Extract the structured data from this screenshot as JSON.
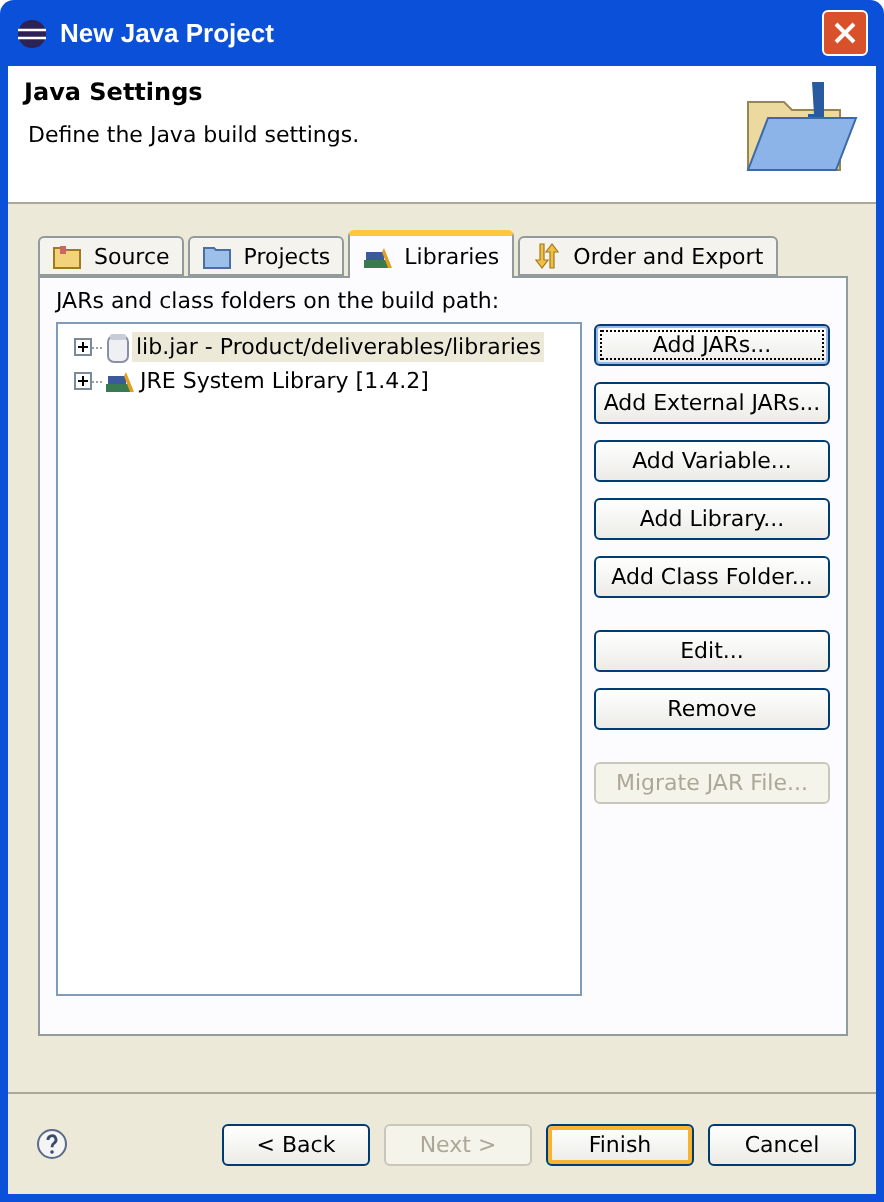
{
  "window": {
    "title": "New Java Project"
  },
  "header": {
    "title": "Java Settings",
    "description": "Define the Java build settings."
  },
  "tabs": [
    {
      "label": "Source",
      "kind": "source",
      "selected": false
    },
    {
      "label": "Projects",
      "kind": "projects",
      "selected": false
    },
    {
      "label": "Libraries",
      "kind": "libraries",
      "selected": true
    },
    {
      "label": "Order and Export",
      "kind": "order",
      "selected": false
    }
  ],
  "build_path": {
    "label": "JARs and class folders on the build path:",
    "items": [
      {
        "label": "lib.jar - Product/deliverables/libraries",
        "kind": "jar",
        "selected": true,
        "expanded": false
      },
      {
        "label": "JRE System Library [1.4.2]",
        "kind": "library",
        "selected": false,
        "expanded": false
      }
    ]
  },
  "side_button_groups": [
    {
      "buttons": [
        {
          "label": "Add JARs...",
          "disabled": false,
          "focused": true
        },
        {
          "label": "Add External JARs...",
          "disabled": false,
          "focused": false
        },
        {
          "label": "Add Variable...",
          "disabled": false,
          "focused": false
        },
        {
          "label": "Add Library...",
          "disabled": false,
          "focused": false
        },
        {
          "label": "Add Class Folder...",
          "disabled": false,
          "focused": false
        }
      ]
    },
    {
      "buttons": [
        {
          "label": "Edit...",
          "disabled": false,
          "focused": false
        },
        {
          "label": "Remove",
          "disabled": false,
          "focused": false
        }
      ]
    },
    {
      "buttons": [
        {
          "label": "Migrate JAR File...",
          "disabled": true,
          "focused": false
        }
      ]
    }
  ],
  "footer_buttons": [
    {
      "label": "< Back",
      "disabled": false,
      "default": false
    },
    {
      "label": "Next >",
      "disabled": true,
      "default": false
    },
    {
      "label": "Finish",
      "disabled": false,
      "default": true
    },
    {
      "label": "Cancel",
      "disabled": false,
      "default": false
    }
  ]
}
